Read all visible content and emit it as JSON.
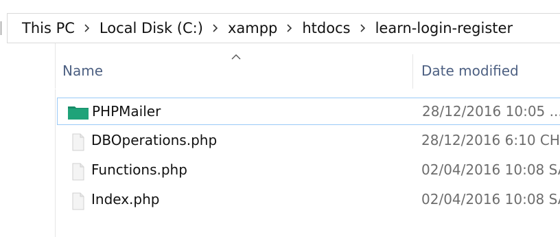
{
  "breadcrumb": {
    "items": [
      {
        "label": "This PC"
      },
      {
        "label": "Local Disk (C:)"
      },
      {
        "label": "xampp"
      },
      {
        "label": "htdocs"
      },
      {
        "label": "learn-login-register"
      }
    ],
    "separator_icon": "chevron-right-icon"
  },
  "columns": {
    "name": "Name",
    "date_modified": "Date modified",
    "sort_indicator_icon": "sort-ascending-icon"
  },
  "files": [
    {
      "name": "PHPMailer",
      "date": "28/12/2016 10:05 ...",
      "type": "folder",
      "icon": "folder-icon",
      "selected": true
    },
    {
      "name": "DBOperations.php",
      "date": "28/12/2016 6:10 CH",
      "type": "file",
      "icon": "file-icon",
      "selected": false
    },
    {
      "name": "Functions.php",
      "date": "02/04/2016 10:08 SA",
      "type": "file",
      "icon": "file-icon",
      "selected": false
    },
    {
      "name": "Index.php",
      "date": "02/04/2016 10:08 SA",
      "type": "file",
      "icon": "file-icon",
      "selected": false
    }
  ],
  "colors": {
    "folder": "#1fa379",
    "selection_border": "#99c9f7",
    "header_text": "#4d6082",
    "date_text": "#6d6d6d"
  }
}
